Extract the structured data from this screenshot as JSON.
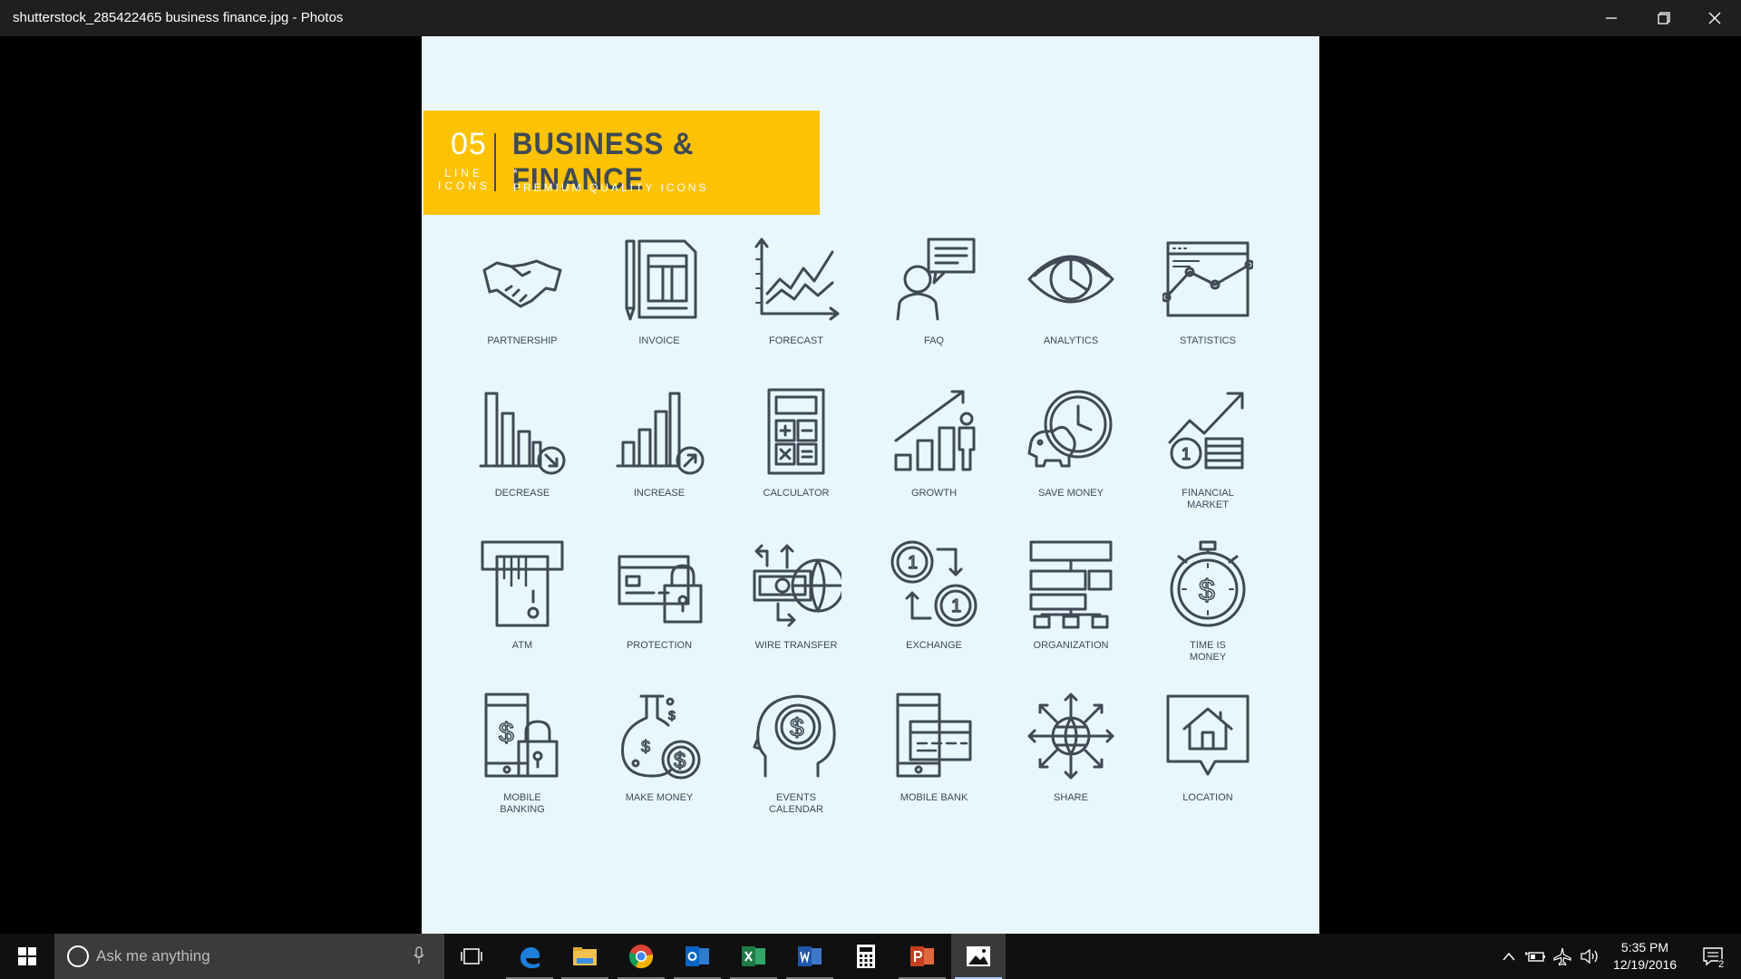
{
  "window": {
    "title": "shutterstock_285422465 business  finance.jpg - Photos"
  },
  "banner": {
    "number": "05",
    "line1": "LINE",
    "line2": "ICONS",
    "heading": "BUSINESS & FINANCE",
    "star": "*",
    "subheading": "PREMIUM QUALITY ICONS"
  },
  "icons": [
    {
      "label": "PARTNERSHIP",
      "icon": "handshake-icon"
    },
    {
      "label": "INVOICE",
      "icon": "invoice-icon"
    },
    {
      "label": "FORECAST",
      "icon": "forecast-icon"
    },
    {
      "label": "FAQ",
      "icon": "faq-icon"
    },
    {
      "label": "ANALYTICS",
      "icon": "eye-icon"
    },
    {
      "label": "STATISTICS",
      "icon": "statistics-icon"
    },
    {
      "label": "DECREASE",
      "icon": "decrease-icon"
    },
    {
      "label": "INCREASE",
      "icon": "increase-icon"
    },
    {
      "label": "CALCULATOR",
      "icon": "calculator-icon"
    },
    {
      "label": "GROWTH",
      "icon": "growth-icon"
    },
    {
      "label": "SAVE MONEY",
      "icon": "piggy-bank-icon"
    },
    {
      "label": "FINANCIAL\nMARKET",
      "icon": "financial-market-icon"
    },
    {
      "label": "ATM",
      "icon": "atm-icon"
    },
    {
      "label": "PROTECTION",
      "icon": "protection-icon"
    },
    {
      "label": "WIRE TRANSFER",
      "icon": "wire-transfer-icon"
    },
    {
      "label": "EXCHANGE",
      "icon": "exchange-icon"
    },
    {
      "label": "ORGANIZATION",
      "icon": "organization-icon"
    },
    {
      "label": "TIME IS\nMONEY",
      "icon": "stopwatch-icon"
    },
    {
      "label": "MOBILE\nBANKING",
      "icon": "mobile-banking-icon"
    },
    {
      "label": "MAKE MONEY",
      "icon": "flask-money-icon"
    },
    {
      "label": "EVENTS\nCALENDAR",
      "icon": "head-dollar-icon"
    },
    {
      "label": "MOBILE BANK",
      "icon": "mobile-bank-icon"
    },
    {
      "label": "SHARE",
      "icon": "globe-share-icon"
    },
    {
      "label": "LOCATION",
      "icon": "location-house-icon"
    }
  ],
  "taskbar": {
    "search_placeholder": "Ask me anything",
    "apps": [
      "task-view-icon",
      "edge-icon",
      "file-explorer-icon",
      "chrome-icon",
      "outlook-icon",
      "excel-icon",
      "word-icon",
      "calculator-app-icon",
      "powerpoint-icon",
      "photos-icon"
    ],
    "time": "5:35 PM",
    "date": "12/19/2016",
    "notification_count": "2"
  },
  "colors": {
    "banner": "#fec205",
    "icon_stroke": "#3f4a55",
    "canvas_bg": "#e9f6fc"
  }
}
